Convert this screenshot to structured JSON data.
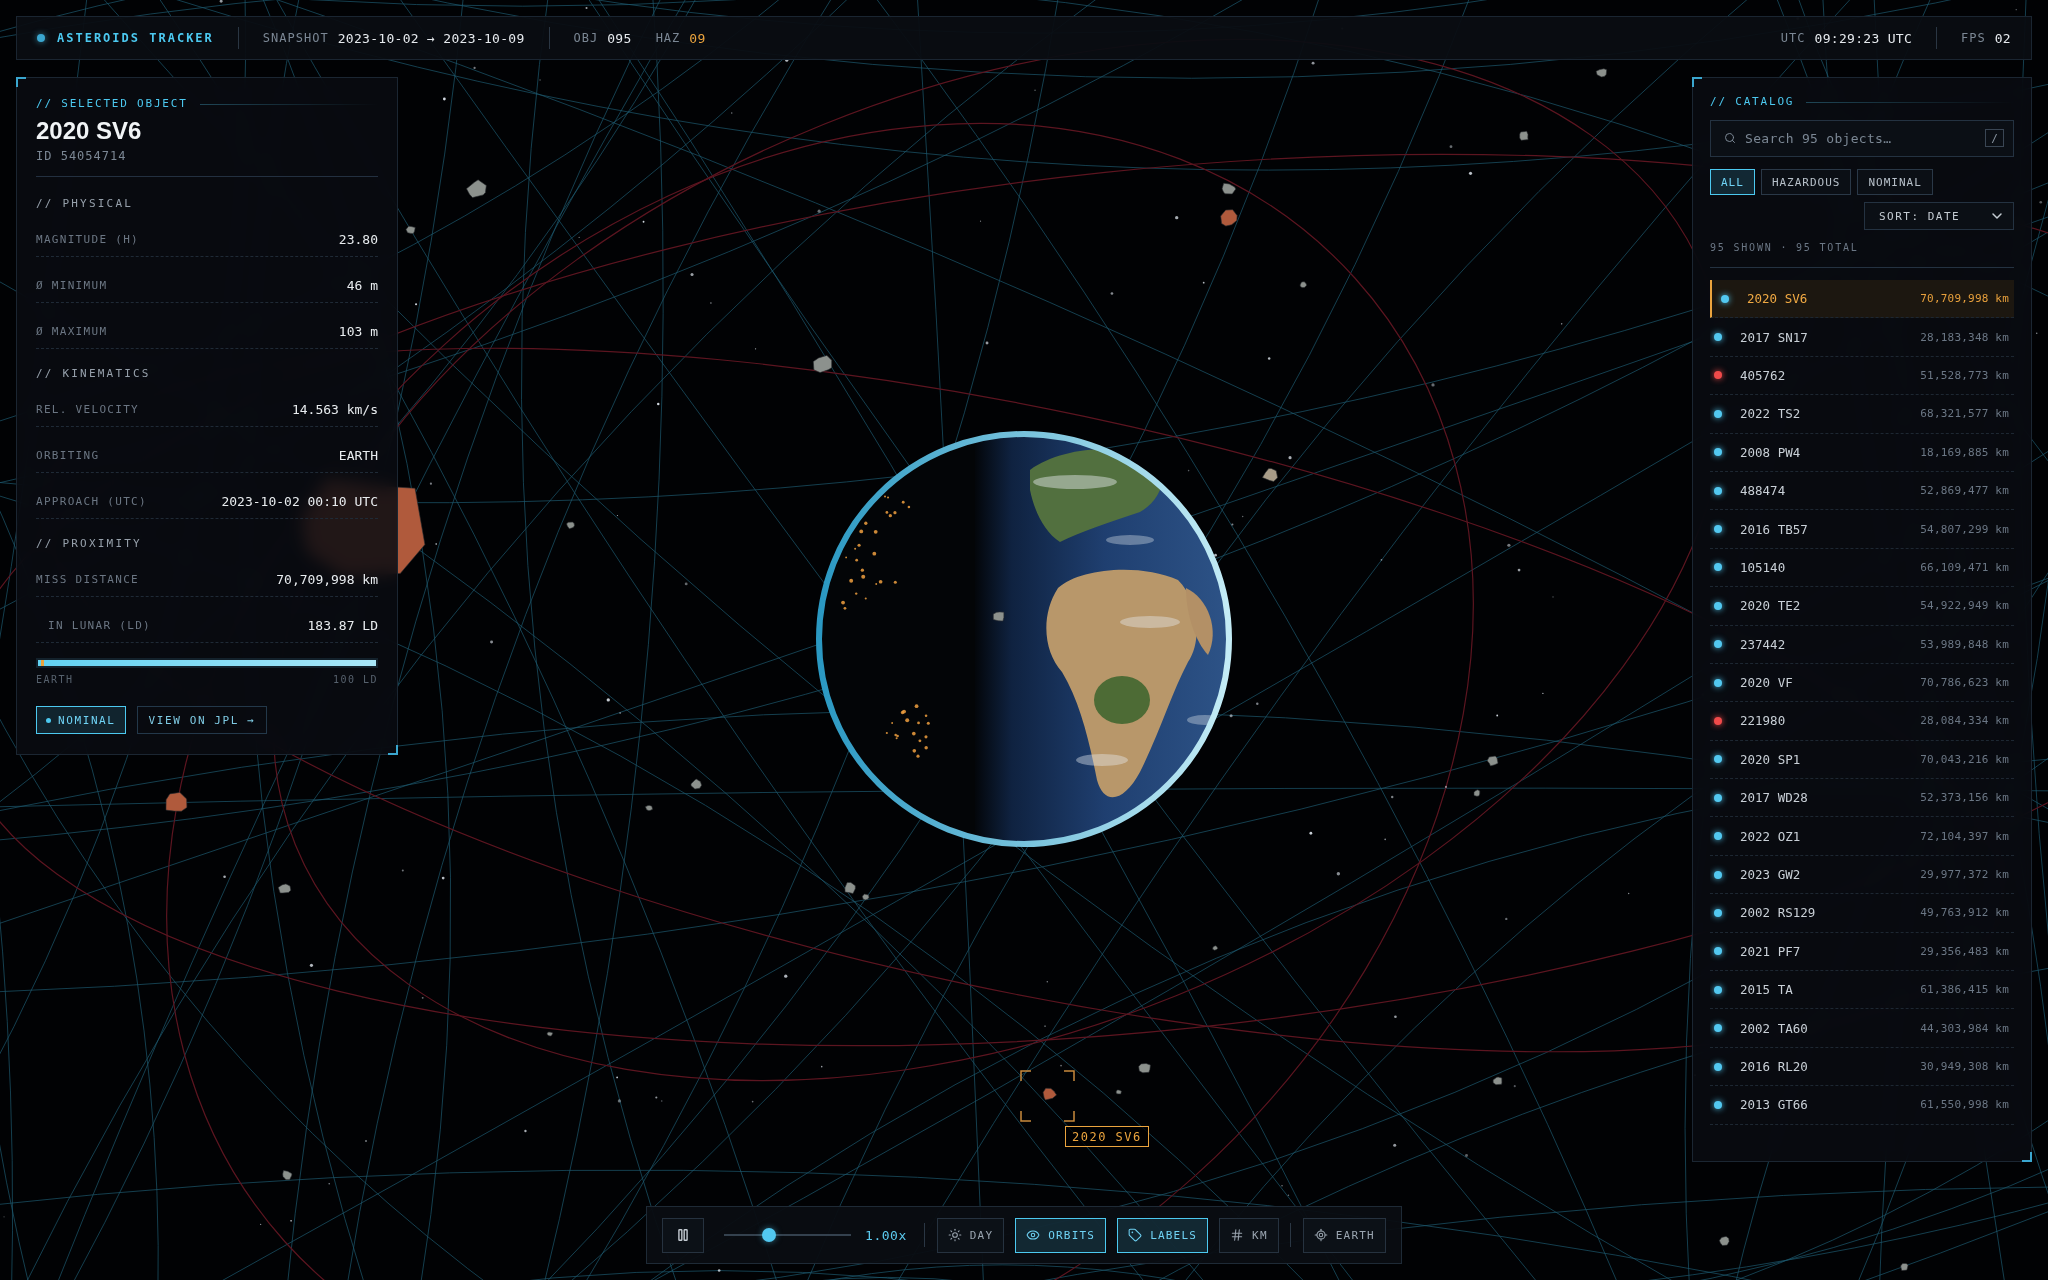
{
  "top_bar": {
    "title": "ASTEROIDS TRACKER",
    "snapshot": {
      "label": "SNAPSHOT",
      "value": "2023-10-02 → 2023-10-09"
    },
    "stats": [
      {
        "label": "OBJ",
        "value": "095",
        "alert": false
      },
      {
        "label": "HAZ",
        "value": "09",
        "alert": true
      }
    ],
    "clock": {
      "label": "UTC",
      "value": "09:29:23 UTC"
    },
    "fps": {
      "label": "FPS",
      "value": "02"
    }
  },
  "selected_object": {
    "heading": "// SELECTED OBJECT",
    "name": "2020 SV6",
    "id": "ID 54054714",
    "sections": [
      {
        "heading": "// PHYSICAL",
        "rows": [
          {
            "label": "MAGNITUDE (H)",
            "value": "23.80"
          },
          {
            "label": "Ø MINIMUM",
            "value": "46 m"
          },
          {
            "label": "Ø MAXIMUM",
            "value": "103 m"
          }
        ]
      },
      {
        "heading": "// KINEMATICS",
        "rows": [
          {
            "label": "REL. VELOCITY",
            "value": "14.563 km/s"
          },
          {
            "label": "ORBITING",
            "value": "EARTH"
          },
          {
            "label": "APPROACH (UTC)",
            "value": "2023-10-02 00:10 UTC"
          }
        ]
      },
      {
        "heading": "// PROXIMITY",
        "rows": [
          {
            "label": "MISS DISTANCE",
            "value": "70,709,998 km",
            "children": [
              {
                "label": "IN LUNAR (LD)",
                "value": "183.87 LD"
              }
            ]
          }
        ]
      }
    ],
    "proximity_bar": {
      "level": 1,
      "start_label": "EARTH",
      "end_label": "100 LD"
    },
    "status": {
      "label": "NOMINAL",
      "hazardous": false
    },
    "link": "VIEW ON JPL →"
  },
  "catalog": {
    "heading": "// CATALOG",
    "search": {
      "placeholder": "Search 95 objects…",
      "shortcut": "/"
    },
    "filters": [
      {
        "label": "ALL",
        "selected": true
      },
      {
        "label": "HAZARDOUS",
        "selected": false
      },
      {
        "label": "NOMINAL",
        "selected": false
      }
    ],
    "sort": "SORT: DATE",
    "summary": "95 SHOWN · 95 TOTAL",
    "items": [
      {
        "name": "2020 SV6",
        "distance": "70,709,998 km",
        "color": "#52c8f0",
        "selected": true
      },
      {
        "name": "2017 SN17",
        "distance": "28,183,348 km",
        "color": "#52c8f0",
        "selected": false
      },
      {
        "name": "405762",
        "distance": "51,528,773 km",
        "color": "#f04a4a",
        "selected": false
      },
      {
        "name": "2022 TS2",
        "distance": "68,321,577 km",
        "color": "#52c8f0",
        "selected": false
      },
      {
        "name": "2008 PW4",
        "distance": "18,169,885 km",
        "color": "#52c8f0",
        "selected": false
      },
      {
        "name": "488474",
        "distance": "52,869,477 km",
        "color": "#52c8f0",
        "selected": false
      },
      {
        "name": "2016 TB57",
        "distance": "54,807,299 km",
        "color": "#52c8f0",
        "selected": false
      },
      {
        "name": "105140",
        "distance": "66,109,471 km",
        "color": "#52c8f0",
        "selected": false
      },
      {
        "name": "2020 TE2",
        "distance": "54,922,949 km",
        "color": "#52c8f0",
        "selected": false
      },
      {
        "name": "237442",
        "distance": "53,989,848 km",
        "color": "#52c8f0",
        "selected": false
      },
      {
        "name": "2020 VF",
        "distance": "70,786,623 km",
        "color": "#52c8f0",
        "selected": false
      },
      {
        "name": "221980",
        "distance": "28,084,334 km",
        "color": "#f04a4a",
        "selected": false
      },
      {
        "name": "2020 SP1",
        "distance": "70,043,216 km",
        "color": "#52c8f0",
        "selected": false
      },
      {
        "name": "2017 WD28",
        "distance": "52,373,156 km",
        "color": "#52c8f0",
        "selected": false
      },
      {
        "name": "2022 OZ1",
        "distance": "72,104,397 km",
        "color": "#52c8f0",
        "selected": false
      },
      {
        "name": "2023 GW2",
        "distance": "29,977,372 km",
        "color": "#52c8f0",
        "selected": false
      },
      {
        "name": "2002 RS129",
        "distance": "49,763,912 km",
        "color": "#52c8f0",
        "selected": false
      },
      {
        "name": "2021 PF7",
        "distance": "29,356,483 km",
        "color": "#52c8f0",
        "selected": false
      },
      {
        "name": "2015 TA",
        "distance": "61,386,415 km",
        "color": "#52c8f0",
        "selected": false
      },
      {
        "name": "2002 TA60",
        "distance": "44,303,984 km",
        "color": "#52c8f0",
        "selected": false
      },
      {
        "name": "2016 RL20",
        "distance": "30,949,308 km",
        "color": "#52c8f0",
        "selected": false
      },
      {
        "name": "2013 GT66",
        "distance": "61,550,998 km",
        "color": "#52c8f0",
        "selected": false
      }
    ]
  },
  "controls": {
    "playing": true,
    "speed": {
      "level": 0.35,
      "reading": "1.00x"
    },
    "toggles": [
      {
        "label": "DAY",
        "on": false
      },
      {
        "label": "ORBITS",
        "on": true
      },
      {
        "label": "LABELS",
        "on": true
      },
      {
        "label": "KM",
        "on": false
      }
    ],
    "focus": {
      "label": "EARTH"
    }
  },
  "scene": {
    "target_label": "2020 SV6"
  }
}
